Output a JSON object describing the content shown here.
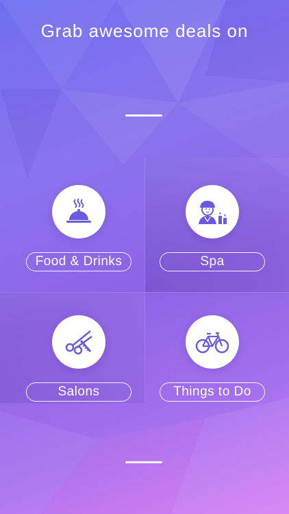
{
  "header": {
    "title": "Grab awesome deals on"
  },
  "categories": [
    {
      "label": "Food & Drinks",
      "icon": "food-cloche-icon"
    },
    {
      "label": "Spa",
      "icon": "spa-person-icon"
    },
    {
      "label": "Salons",
      "icon": "scissors-comb-icon"
    },
    {
      "label": "Things to Do",
      "icon": "bicycle-icon"
    }
  ],
  "colors": {
    "accent": "#6a5ae0",
    "background_top": "#6f6ef0",
    "background_bottom": "#d77ff4"
  }
}
